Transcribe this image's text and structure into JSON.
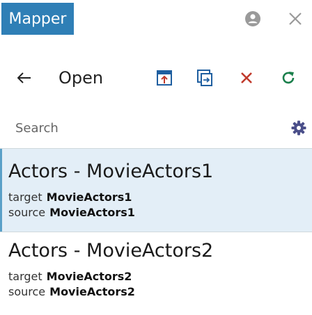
{
  "window": {
    "title": "Mapper",
    "colors": {
      "accent": "#2f7fb6",
      "selected_bg": "#e3eef7",
      "icon_red": "#c0392b",
      "icon_green": "#1a7f4b",
      "icon_blue": "#1f5fa0"
    }
  },
  "toolbar": {
    "back_icon": "arrow-left-icon",
    "open_label": "Open"
  },
  "search": {
    "placeholder": "Search",
    "value": ""
  },
  "mappings": [
    {
      "title": "Actors - MovieActors1",
      "target_key": "target",
      "target_value": "MovieActors1",
      "source_key": "source",
      "source_value": "MovieActors1",
      "selected": true
    },
    {
      "title": "Actors - MovieActors2",
      "target_key": "target",
      "target_value": "MovieActors2",
      "source_key": "source",
      "source_value": "MovieActors2",
      "selected": false
    }
  ]
}
